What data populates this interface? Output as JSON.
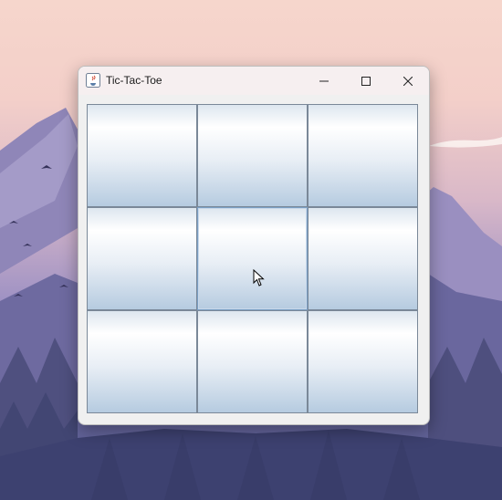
{
  "window": {
    "title": "Tic-Tac-Toe",
    "controls": {
      "minimize_icon": "minimize-icon",
      "maximize_icon": "maximize-icon",
      "close_icon": "close-icon"
    }
  },
  "board": {
    "rows": 3,
    "cols": 3,
    "cells": [
      "",
      "",
      "",
      "",
      "",
      "",
      "",
      "",
      ""
    ]
  }
}
